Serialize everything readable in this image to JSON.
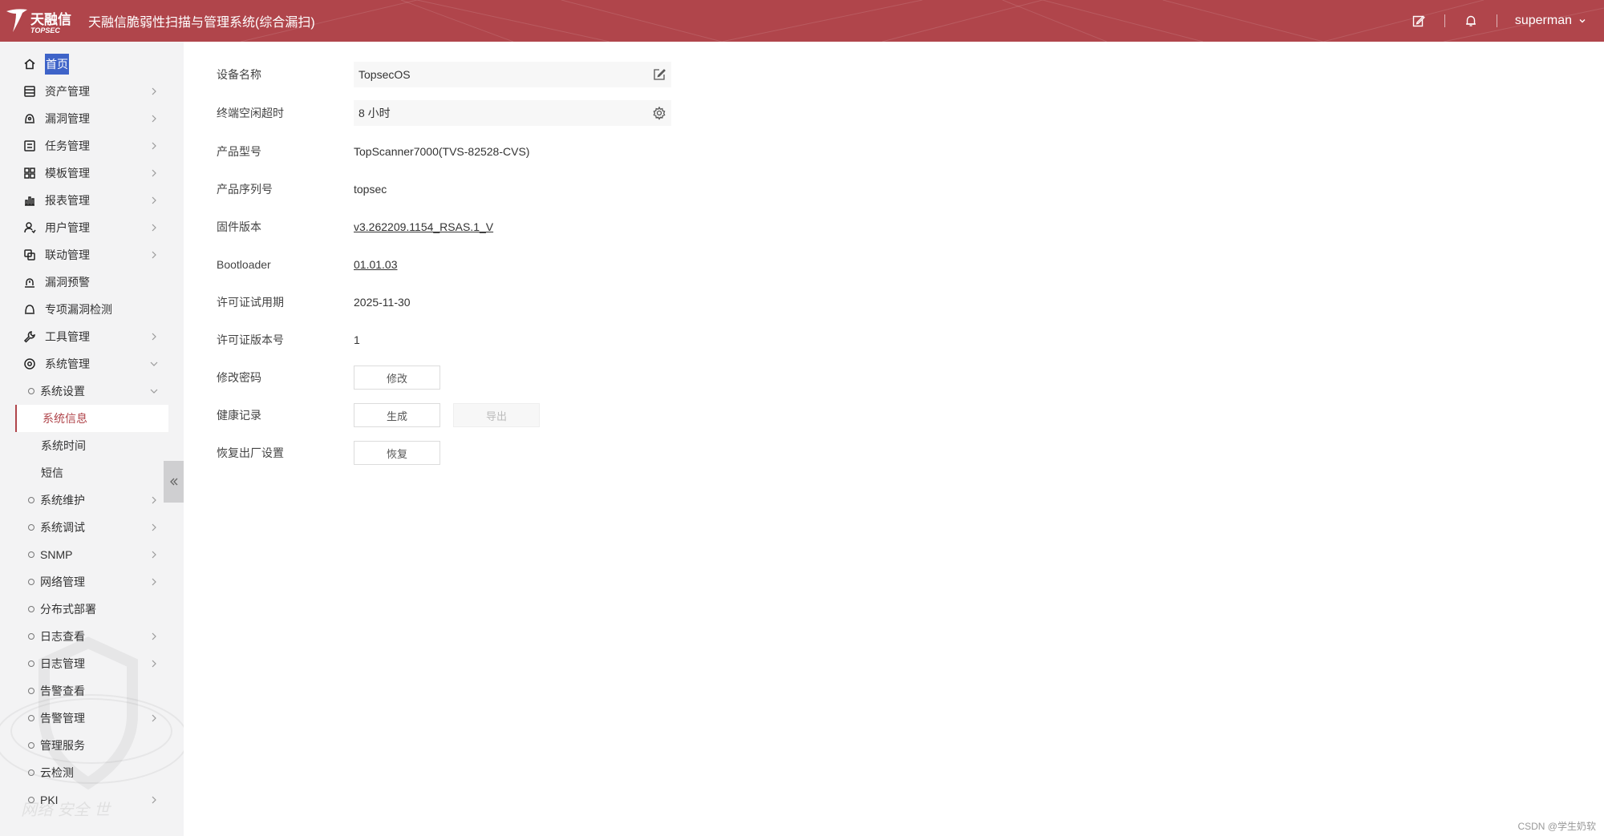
{
  "header": {
    "logo_cn": "天融信",
    "logo_en": "TOPSEC",
    "title": "天融信脆弱性扫描与管理系统(综合漏扫)",
    "user": "superman"
  },
  "sidebar": {
    "items": [
      {
        "label": "首页",
        "icon": "home-icon"
      },
      {
        "label": "资产管理",
        "icon": "asset-icon"
      },
      {
        "label": "漏洞管理",
        "icon": "vulnerability-icon"
      },
      {
        "label": "任务管理",
        "icon": "task-icon"
      },
      {
        "label": "模板管理",
        "icon": "template-icon"
      },
      {
        "label": "报表管理",
        "icon": "report-icon"
      },
      {
        "label": "用户管理",
        "icon": "user-icon"
      },
      {
        "label": "联动管理",
        "icon": "linkage-icon"
      },
      {
        "label": "漏洞预警",
        "icon": "alert-icon"
      },
      {
        "label": "专项漏洞检测",
        "icon": "detect-icon"
      },
      {
        "label": "工具管理",
        "icon": "tool-icon"
      },
      {
        "label": "系统管理",
        "icon": "system-icon"
      }
    ],
    "system_sub": [
      {
        "label": "系统设置"
      },
      {
        "label": "系统信息"
      },
      {
        "label": "系统时间"
      },
      {
        "label": "短信"
      },
      {
        "label": "系统维护"
      },
      {
        "label": "系统调试"
      },
      {
        "label": "SNMP"
      },
      {
        "label": "网络管理"
      },
      {
        "label": "分布式部署"
      },
      {
        "label": "日志查看"
      },
      {
        "label": "日志管理"
      },
      {
        "label": "告警查看"
      },
      {
        "label": "告警管理"
      },
      {
        "label": "管理服务"
      },
      {
        "label": "云检测"
      },
      {
        "label": "PKI"
      }
    ],
    "watermark": "网络 安全 世"
  },
  "info": {
    "device_name_label": "设备名称",
    "device_name": "TopsecOS",
    "idle_timeout_label": "终端空闲超时",
    "idle_timeout": "8 小时",
    "model_label": "产品型号",
    "model": "TopScanner7000(TVS-82528-CVS)",
    "serial_label": "产品序列号",
    "serial": "topsec",
    "firmware_label": "固件版本",
    "firmware": "v3.262209.1154_RSAS.1_V",
    "bootloader_label": "Bootloader",
    "bootloader": "01.01.03",
    "license_expiry_label": "许可证试用期",
    "license_expiry": "2025-11-30",
    "license_version_label": "许可证版本号",
    "license_version": "1",
    "change_password_label": "修改密码",
    "change_password_btn": "修改",
    "health_record_label": "健康记录",
    "generate_btn": "生成",
    "export_btn": "导出",
    "factory_reset_label": "恢复出厂设置",
    "restore_btn": "恢复"
  },
  "footer_watermark": "CSDN @学生奶软",
  "colors": {
    "brand": "#b0454b",
    "link": "#2f6fd6",
    "home_highlight": "#3e63c8"
  }
}
